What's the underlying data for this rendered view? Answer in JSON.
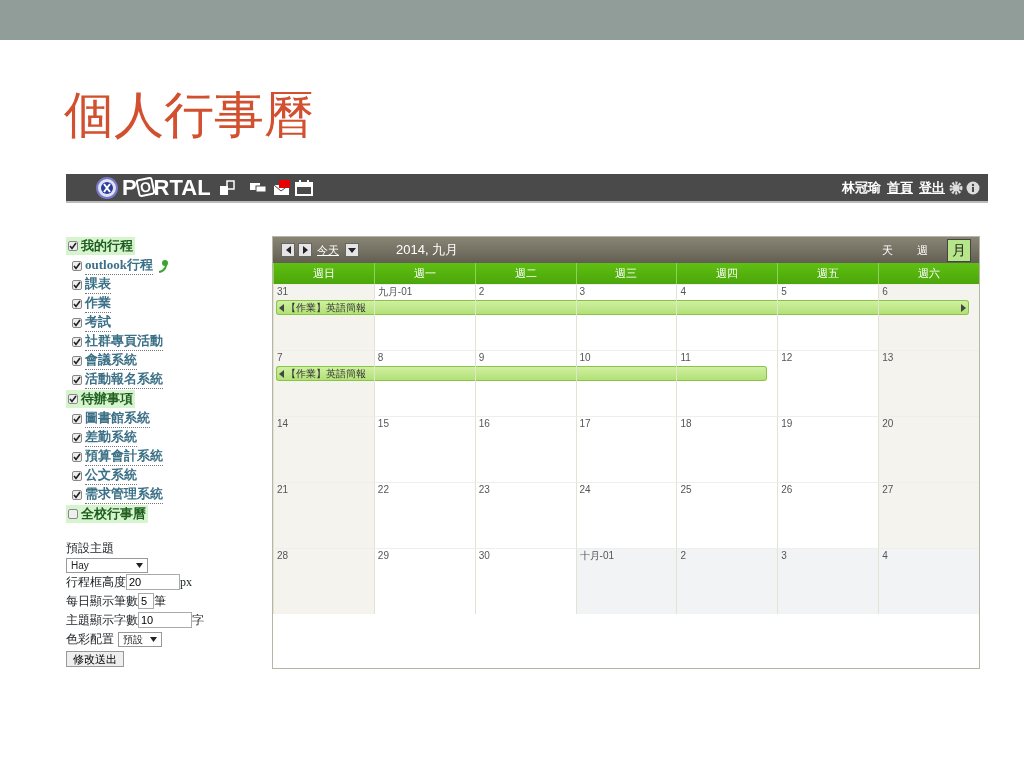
{
  "slide_title": "個人行事曆",
  "navbar": {
    "logo": "PORTAL",
    "user": "林冠瑜",
    "links": [
      "首頁",
      "登出"
    ]
  },
  "sidebar": {
    "items": [
      {
        "label": "我的行程",
        "checked": true,
        "children": [
          {
            "label": "outlook行程",
            "checked": true,
            "has_sync_icon": true
          },
          {
            "label": "課表",
            "checked": true
          },
          {
            "label": "作業",
            "checked": true
          },
          {
            "label": "考試",
            "checked": true
          },
          {
            "label": "社群專頁活動",
            "checked": true
          },
          {
            "label": "會議系統",
            "checked": true
          },
          {
            "label": "活動報名系統",
            "checked": true
          }
        ]
      },
      {
        "label": "待辦事項",
        "checked": true,
        "children": [
          {
            "label": "圖書館系統",
            "checked": true
          },
          {
            "label": "差勤系統",
            "checked": true
          },
          {
            "label": "預算會計系統",
            "checked": true
          },
          {
            "label": "公文系統",
            "checked": true
          },
          {
            "label": "需求管理系統",
            "checked": true
          }
        ]
      },
      {
        "label": "全校行事曆",
        "checked": false
      }
    ]
  },
  "settings": {
    "fields": [
      {
        "kind": "heading",
        "label": "預設主題"
      },
      {
        "kind": "select",
        "value": "Hay"
      },
      {
        "kind": "input",
        "label": "行程框高度",
        "value": "20",
        "suffix": "px"
      },
      {
        "kind": "input",
        "label": "每日顯示筆數",
        "value": "5",
        "suffix": "筆"
      },
      {
        "kind": "input",
        "label": "主題顯示字數",
        "value": "10",
        "suffix": "字"
      },
      {
        "kind": "labeled_select",
        "label": "色彩配置",
        "value": "預設"
      }
    ],
    "submit": "修改送出"
  },
  "calendar": {
    "today_button": "今天",
    "title": "2014, 九月",
    "views": [
      {
        "label": "天",
        "selected": false
      },
      {
        "label": "週",
        "selected": false
      },
      {
        "label": "月",
        "selected": true
      }
    ],
    "columns": [
      "週日",
      "週一",
      "週二",
      "週三",
      "週四",
      "週五",
      "週六"
    ],
    "weeks": [
      {
        "days": [
          {
            "label": "31",
            "kind": "weekend"
          },
          {
            "label": "九月-01",
            "kind": "weekday"
          },
          {
            "label": "2",
            "kind": "weekday"
          },
          {
            "label": "3",
            "kind": "weekday"
          },
          {
            "label": "4",
            "kind": "weekday"
          },
          {
            "label": "5",
            "kind": "weekday"
          },
          {
            "label": "6",
            "kind": "weekend"
          }
        ],
        "event": {
          "label": "【作業】英語簡報",
          "days_covered": [
            true,
            true,
            true,
            true,
            true,
            true,
            true
          ],
          "continues_left": true,
          "continues_right": true
        }
      },
      {
        "days": [
          {
            "label": "7",
            "kind": "weekend"
          },
          {
            "label": "8",
            "kind": "weekday"
          },
          {
            "label": "9",
            "kind": "weekday"
          },
          {
            "label": "10",
            "kind": "weekday"
          },
          {
            "label": "11",
            "kind": "weekday"
          },
          {
            "label": "12",
            "kind": "weekday"
          },
          {
            "label": "13",
            "kind": "weekend"
          }
        ],
        "event": {
          "label": "【作業】英語簡報",
          "days_covered": [
            true,
            true,
            true,
            true,
            true,
            false,
            false
          ],
          "continues_left": true,
          "continues_right": false
        }
      },
      {
        "days": [
          {
            "label": "14",
            "kind": "weekend"
          },
          {
            "label": "15",
            "kind": "weekday"
          },
          {
            "label": "16",
            "kind": "weekday"
          },
          {
            "label": "17",
            "kind": "weekday"
          },
          {
            "label": "18",
            "kind": "weekday"
          },
          {
            "label": "19",
            "kind": "weekday"
          },
          {
            "label": "20",
            "kind": "weekend"
          }
        ]
      },
      {
        "days": [
          {
            "label": "21",
            "kind": "weekend"
          },
          {
            "label": "22",
            "kind": "weekday"
          },
          {
            "label": "23",
            "kind": "weekday"
          },
          {
            "label": "24",
            "kind": "weekday"
          },
          {
            "label": "25",
            "kind": "weekday"
          },
          {
            "label": "26",
            "kind": "weekday"
          },
          {
            "label": "27",
            "kind": "weekend"
          }
        ]
      },
      {
        "days": [
          {
            "label": "28",
            "kind": "weekend"
          },
          {
            "label": "29",
            "kind": "weekday"
          },
          {
            "label": "30",
            "kind": "weekday"
          },
          {
            "label": "十月-01",
            "kind": "other_month"
          },
          {
            "label": "2",
            "kind": "other_month"
          },
          {
            "label": "3",
            "kind": "other_month"
          },
          {
            "label": "4",
            "kind": "other_month"
          }
        ]
      }
    ]
  }
}
